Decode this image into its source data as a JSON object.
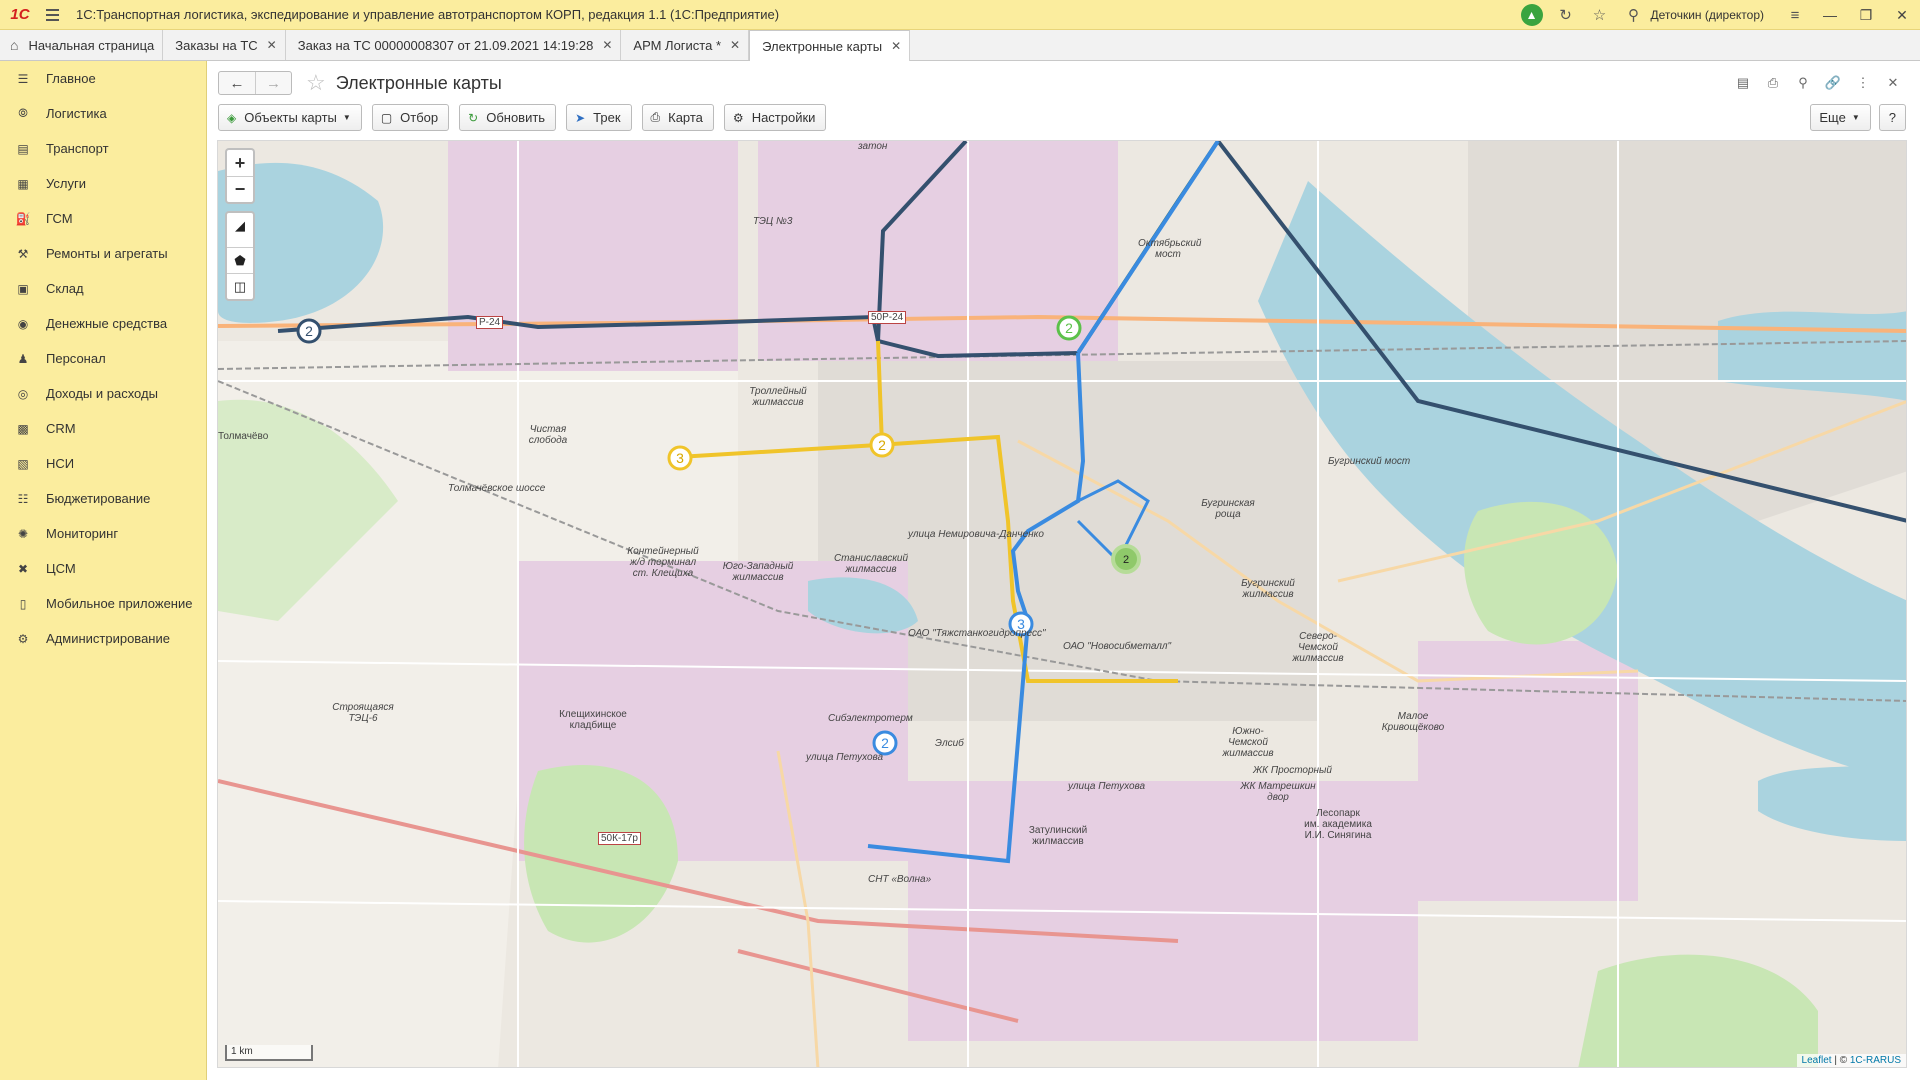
{
  "titlebar": {
    "logo": "1C",
    "title": "1С:Транспортная логистика, экспедирование и управление автотранспортом КОРП, редакция 1.1  (1С:Предприятие)",
    "user": "Деточкин (директор)"
  },
  "tabs": [
    {
      "label": "Начальная страница"
    },
    {
      "label": "Заказы на ТС"
    },
    {
      "label": "Заказ на ТС 00000008307 от 21.09.2021 14:19:28"
    },
    {
      "label": "АРМ Логиста *"
    },
    {
      "label": "Электронные карты"
    }
  ],
  "sidebar": {
    "items": [
      {
        "label": "Главное",
        "icon": "menu-icon"
      },
      {
        "label": "Логистика",
        "icon": "compass-icon"
      },
      {
        "label": "Транспорт",
        "icon": "truck-icon"
      },
      {
        "label": "Услуги",
        "icon": "document-icon"
      },
      {
        "label": "ГСМ",
        "icon": "fuel-icon"
      },
      {
        "label": "Ремонты и агрегаты",
        "icon": "wrench-icon"
      },
      {
        "label": "Склад",
        "icon": "warehouse-icon"
      },
      {
        "label": "Денежные средства",
        "icon": "money-icon"
      },
      {
        "label": "Персонал",
        "icon": "person-icon"
      },
      {
        "label": "Доходы и расходы",
        "icon": "coins-icon"
      },
      {
        "label": "CRM",
        "icon": "crm-icon"
      },
      {
        "label": "НСИ",
        "icon": "book-icon"
      },
      {
        "label": "Бюджетирование",
        "icon": "budget-icon"
      },
      {
        "label": "Мониторинг",
        "icon": "satellite-icon"
      },
      {
        "label": "ЦСМ",
        "icon": "gear-cross-icon"
      },
      {
        "label": "Мобильное приложение",
        "icon": "phone-icon"
      },
      {
        "label": "Администрирование",
        "icon": "gear-icon"
      }
    ]
  },
  "page": {
    "title": "Электронные карты"
  },
  "toolbar": {
    "map_objects": "Объекты карты",
    "filter": "Отбор",
    "refresh": "Обновить",
    "track": "Трек",
    "map": "Карта",
    "settings": "Настройки",
    "more": "Еще",
    "help": "?"
  },
  "map": {
    "zoom_in": "+",
    "zoom_out": "−",
    "scale_label": "1 km",
    "attribution_leaflet": "Leaflet",
    "attribution_sep": " | © ",
    "attribution_owner": "1C-RARUS",
    "labels": {
      "tolmachevo": "Толмачёво",
      "chistaya": "Чистая\nслобода",
      "trolleybus": "Троллейный\nжилмассив",
      "container": "Контейнерный\nж/д терминал\nст. Клещиха",
      "yugozapad": "Юго-Западный\nжилмассив",
      "stanislav": "Станиславский\nжилмассив",
      "tyazhstank": "ОАО \"Тяжстанкогидропресс\"",
      "novosibmetal": "ОАО \"Новосибметалл\"",
      "bugrinskaya": "Бугринская\nроща",
      "bugrinsky": "Бугринский\nжилмассив",
      "severo": "Северо-\nЧемской\nжилмассив",
      "kleshchikha": "Клещихинское\nкладбище",
      "tets6": "Строящаяся\nТЭЦ-6",
      "sibelektro": "Сибэлектротерм",
      "elsib": "Элсиб",
      "zatulinsky": "Затулинский\nжилмассив",
      "yuzhno": "Южно-\nЧемской\nжилмассив",
      "prostorny": "ЖК Просторный",
      "matreshkin": "ЖК Матрешкин\nдвор",
      "malo": "Малое\nКривощёково",
      "lesopark": "Лесопарк\nим. академика\nИ.И. Синягина",
      "oktyabrsky": "Октябрьский\nмост",
      "tets3": "ТЭЦ №3",
      "zaton": "затон",
      "petukhova1": "улица Петухова",
      "petukhova2": "улица Петухова",
      "nemirovich": "улица Немировича-Данченко",
      "bugrinsky_most": "Бугринский мост",
      "tolmach_shosse": "Толмачёвское шоссе",
      "r24a": "Р-24",
      "r24b": "50Р-24",
      "r50k": "50К-17р",
      "volna": "СНТ «Волна»"
    },
    "markers": {
      "yellow3": "3",
      "yellow2": "2",
      "navy2": "2",
      "green2": "2",
      "cluster2": "2",
      "blue3": "3",
      "blue2": "2"
    },
    "colors": {
      "navy_route": "#34506e",
      "yellow_route": "#f0c42a",
      "blue_route": "#3a8be0",
      "teal_route": "#2c6b6a",
      "green_marker": "#5cc14a",
      "water": "#aad3df",
      "park": "#c8e6b4",
      "industrial": "#e2cbe0"
    }
  }
}
